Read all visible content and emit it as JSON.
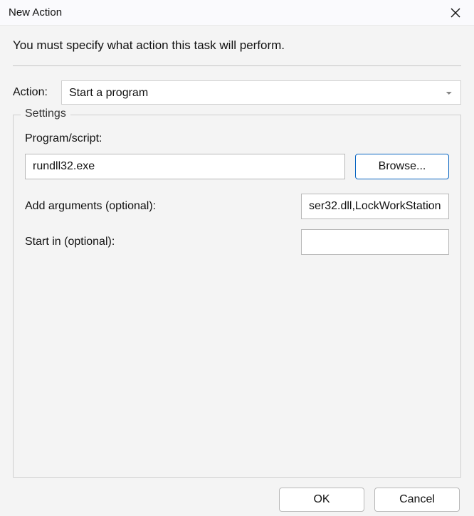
{
  "window": {
    "title": "New Action"
  },
  "instruction": "You must specify what action this task will perform.",
  "action": {
    "label": "Action:",
    "selected": "Start a program"
  },
  "settings": {
    "legend": "Settings",
    "program": {
      "label": "Program/script:",
      "value": "rundll32.exe",
      "browse_label": "Browse..."
    },
    "arguments": {
      "label": "Add arguments (optional):",
      "value": "ser32.dll,LockWorkStation"
    },
    "startin": {
      "label": "Start in (optional):",
      "value": ""
    }
  },
  "buttons": {
    "ok": "OK",
    "cancel": "Cancel"
  }
}
